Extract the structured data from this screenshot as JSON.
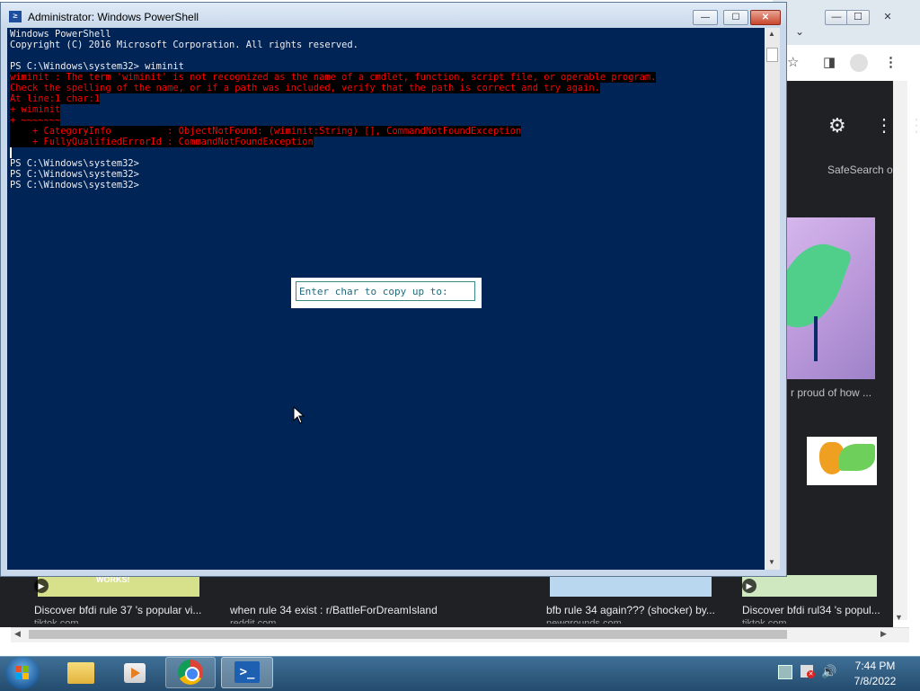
{
  "browser": {
    "window_buttons": {
      "minimize": "—",
      "maximize": "☐",
      "close": "✕"
    },
    "safesearch_label": "SafeSearch o",
    "image_caption": "r proud of how ...",
    "results": [
      {
        "title": "Discover bfdi rule 37 's popular vi...",
        "source": "tiktok.com",
        "thumb_text": "WORKS!"
      },
      {
        "title": "when rule 34 exist : r/BattleForDreamIsland",
        "source": "reddit.com"
      },
      {
        "title": "bfb rule 34 again??? (shocker) by...",
        "source": "newgrounds.com"
      },
      {
        "title": "Discover bfdi rul34 's popul...",
        "source": "tiktok.com"
      }
    ]
  },
  "powershell": {
    "title": "Administrator: Windows PowerShell",
    "icon_glyph": "≥",
    "controls": {
      "minimize": "—",
      "maximize": "☐",
      "close": "✕"
    },
    "console": {
      "banner": [
        "Windows PowerShell",
        "Copyright (C) 2016 Microsoft Corporation. All rights reserved."
      ],
      "command_line": "PS C:\\Windows\\system32> wiminit",
      "error_lines": [
        "wiminit : The term 'wiminit' is not recognized as the name of a cmdlet, function, script file, or operable program.",
        "Check the spelling of the name, or if a path was included, verify that the path is correct and try again.",
        "At line:1 char:1",
        "+ wiminit",
        "+ ~~~~~~~",
        "    + CategoryInfo          : ObjectNotFound: (wiminit:String) [], CommandNotFoundException",
        "    + FullyQualifiedErrorId : CommandNotFoundException"
      ],
      "prompts": [
        "PS C:\\Windows\\system32>",
        "PS C:\\Windows\\system32>",
        "PS C:\\Windows\\system32>"
      ]
    },
    "mark_dialog_text": "Enter char to copy up to:"
  },
  "taskbar": {
    "clock_time": "7:44 PM",
    "clock_date": "7/8/2022",
    "ps_glyph": ">_",
    "volume_glyph": "🔊"
  },
  "colors": {
    "console_bg": "#012456",
    "error_fg": "#ff0000",
    "error_bg": "#000000",
    "console_fg": "#eeedf0"
  }
}
